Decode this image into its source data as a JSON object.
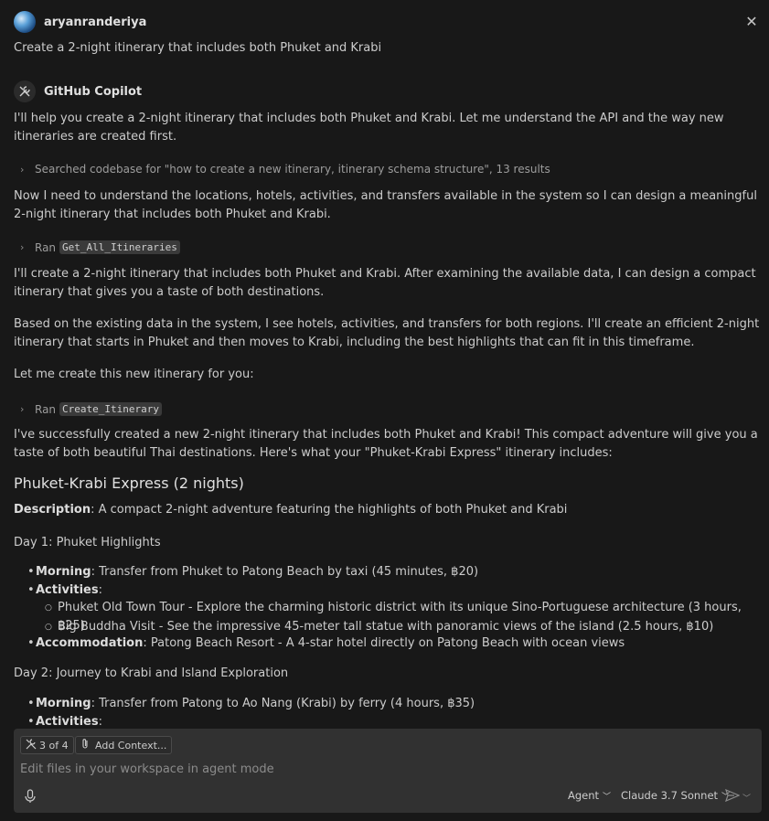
{
  "user": {
    "name": "aryanranderiya",
    "message": "Create a 2-night itinerary that includes both Phuket and Krabi"
  },
  "assistant": {
    "name": "GitHub Copilot",
    "intro": "I'll help you create a 2-night itinerary that includes both Phuket and Krabi. Let me understand the API and the way new itineraries are created first.",
    "step_search": "Searched codebase for \"how to create a new itinerary, itinerary schema structure\", 13 results",
    "para2": "Now I need to understand the locations, hotels, activities, and transfers available in the system so I can design a meaningful 2-night itinerary that includes both Phuket and Krabi.",
    "ran_label": "Ran",
    "tool1": "Get_All_Itineraries",
    "para3": "I'll create a 2-night itinerary that includes both Phuket and Krabi. After examining the available data, I can design a compact itinerary that gives you a taste of both destinations.",
    "para4": "Based on the existing data in the system, I see hotels, activities, and transfers for both regions. I'll create an efficient 2-night itinerary that starts in Phuket and then moves to Krabi, including the best highlights that can fit in this timeframe.",
    "para5": "Let me create this new itinerary for you:",
    "tool2": "Create_Itinerary",
    "para6": "I've successfully created a new 2-night itinerary that includes both Phuket and Krabi! This compact adventure will give you a taste of both beautiful Thai destinations. Here's what your \"Phuket-Krabi Express\" itinerary includes:",
    "itinerary_title": "Phuket-Krabi Express (2 nights)",
    "desc_label": "Description",
    "desc_text": ": A compact 2-night adventure featuring the highlights of both Phuket and Krabi",
    "day1_title": "Day 1: Phuket Highlights",
    "day1_morning_label": "Morning",
    "day1_morning_text": ": Transfer from Phuket to Patong Beach by taxi (45 minutes, ฿20)",
    "activities_label": "Activities",
    "activities_colon": ":",
    "day1_act1": "Phuket Old Town Tour - Explore the charming historic district with its unique Sino-Portuguese architecture (3 hours, ฿25)",
    "day1_act2": "Big Buddha Visit - See the impressive 45-meter tall statue with panoramic views of the island (2.5 hours, ฿10)",
    "accommodation_label": "Accommodation",
    "day1_accommodation_text": ": Patong Beach Resort - A 4-star hotel directly on Patong Beach with ocean views",
    "day2_title": "Day 2: Journey to Krabi and Island Exploration",
    "day2_morning_label": "Morning",
    "day2_morning_text": ": Transfer from Patong to Ao Nang (Krabi) by ferry (4 hours, ฿35)",
    "day2_activities_label": "Activities"
  },
  "input": {
    "tools_chip": "3 of 4",
    "add_context": "Add Context...",
    "placeholder": "Edit files in your workspace in agent mode",
    "mode": "Agent",
    "model": "Claude 3.7 Sonnet"
  }
}
